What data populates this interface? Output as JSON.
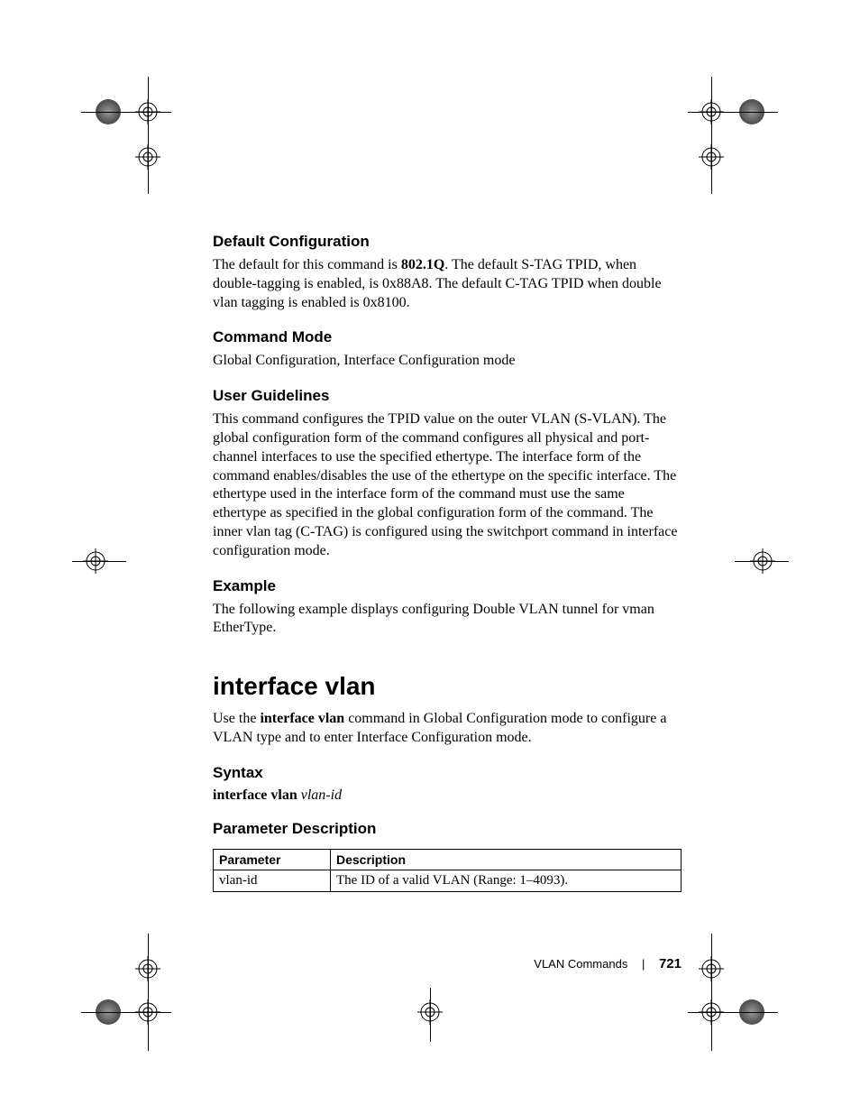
{
  "sections": {
    "default_config": {
      "heading": "Default Configuration",
      "body_pre": "The default for this command is ",
      "body_bold": "802.1Q",
      "body_post": ". The default S-TAG TPID, when double-tagging is enabled, is 0x88A8. The default C-TAG TPID when double vlan tagging is enabled is 0x8100."
    },
    "command_mode": {
      "heading": "Command Mode",
      "body": "Global Configuration, Interface Configuration mode"
    },
    "user_guidelines": {
      "heading": "User Guidelines",
      "body": "This command configures the TPID value on the outer VLAN (S-VLAN). The global configuration form of the command configures all physical and port-channel interfaces to use the specified ethertype. The interface form of the command enables/disables the use of the ethertype on the specific interface. The ethertype used in the interface form of the command must use the same ethertype as specified in the global configuration form of the command. The inner vlan tag (C-TAG) is configured using the switchport command in interface configuration mode."
    },
    "example": {
      "heading": "Example",
      "body": "The following example displays configuring Double VLAN tunnel for vman EtherType."
    }
  },
  "command": {
    "title": "interface vlan",
    "intro_pre": "Use the ",
    "intro_bold": "interface vlan",
    "intro_post": " command in Global Configuration mode to configure a VLAN type and to enter Interface Configuration mode.",
    "syntax_heading": "Syntax",
    "syntax_bold": "interface vlan",
    "syntax_italic": "vlan-id",
    "param_heading": "Parameter Description",
    "table": {
      "col1_header": "Parameter",
      "col2_header": "Description",
      "row1_param": "vlan-id",
      "row1_desc": "The ID of a valid VLAN (Range: 1–4093)."
    }
  },
  "footer": {
    "section": "VLAN Commands",
    "page": "721"
  }
}
